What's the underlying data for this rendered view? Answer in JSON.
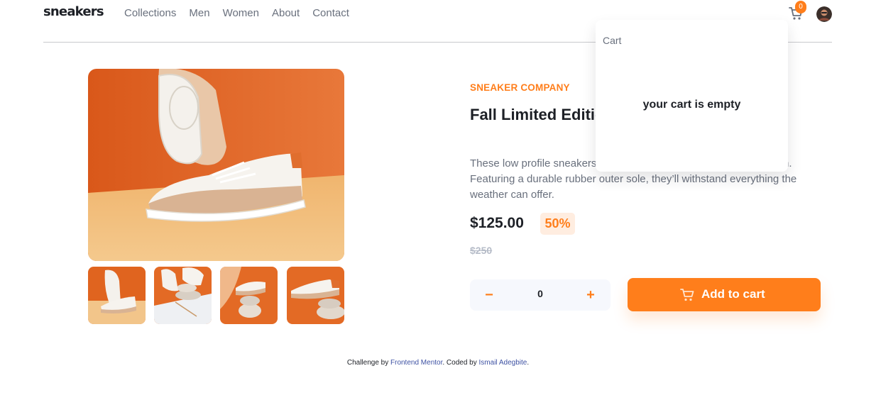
{
  "header": {
    "logo": "sneakers",
    "nav": [
      "Collections",
      "Men",
      "Women",
      "About",
      "Contact"
    ],
    "cart_count": "0"
  },
  "cart": {
    "title": "Cart",
    "empty_message": "your cart is empty"
  },
  "product": {
    "company": "SNEAKER COMPANY",
    "title": "Fall Limited Edition Sneaker",
    "description": "These low profile sneakers are your perfect casual wear companion. Featuring a durable rubber outer sole, they’ll withstand everything the weather can offer.",
    "price": "$125.00",
    "discount": "50%",
    "original_price": "$250"
  },
  "quantity": {
    "minus": "−",
    "value": "0",
    "plus": "+"
  },
  "add_to_cart": {
    "label": "Add to cart",
    "icon": "cart-icon"
  },
  "footer": {
    "prefix": "Challenge by ",
    "link1": "Frontend Mentor",
    "middle": ". Coded by ",
    "link2": "Ismail Adegbite",
    "suffix": "."
  },
  "colors": {
    "accent": "#ff7e1b",
    "accent_light": "#ffede0",
    "dark": "#1d2026",
    "grey": "#69707d"
  }
}
